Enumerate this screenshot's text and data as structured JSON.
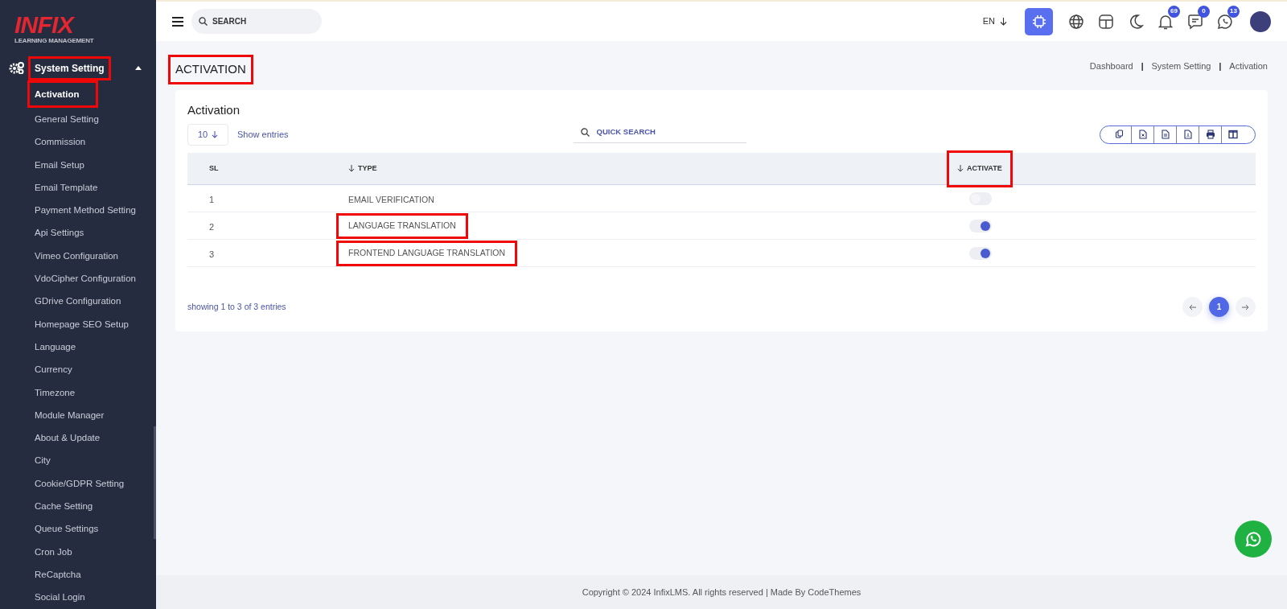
{
  "logo": {
    "title": "INFIX",
    "subtitle": "LEARNING MANAGEMENT"
  },
  "sidebar": {
    "section": {
      "label": "System Setting",
      "expanded": true,
      "highlighted": true
    },
    "items": [
      {
        "label": "Activation",
        "selected": true,
        "highlighted": true
      },
      {
        "label": "General Setting",
        "selected": false,
        "highlighted": false
      },
      {
        "label": "Commission",
        "selected": false,
        "highlighted": false
      },
      {
        "label": "Email Setup",
        "selected": false,
        "highlighted": false
      },
      {
        "label": "Email Template",
        "selected": false,
        "highlighted": false
      },
      {
        "label": "Payment Method Setting",
        "selected": false,
        "highlighted": false
      },
      {
        "label": "Api Settings",
        "selected": false,
        "highlighted": false
      },
      {
        "label": "Vimeo Configuration",
        "selected": false,
        "highlighted": false
      },
      {
        "label": "VdoCipher Configuration",
        "selected": false,
        "highlighted": false
      },
      {
        "label": "GDrive Configuration",
        "selected": false,
        "highlighted": false
      },
      {
        "label": "Homepage SEO Setup",
        "selected": false,
        "highlighted": false
      },
      {
        "label": "Language",
        "selected": false,
        "highlighted": false
      },
      {
        "label": "Currency",
        "selected": false,
        "highlighted": false
      },
      {
        "label": "Timezone",
        "selected": false,
        "highlighted": false
      },
      {
        "label": "Module Manager",
        "selected": false,
        "highlighted": false
      },
      {
        "label": "About & Update",
        "selected": false,
        "highlighted": false
      },
      {
        "label": "City",
        "selected": false,
        "highlighted": false
      },
      {
        "label": "Cookie/GDPR Setting",
        "selected": false,
        "highlighted": false
      },
      {
        "label": "Cache Setting",
        "selected": false,
        "highlighted": false
      },
      {
        "label": "Queue Settings",
        "selected": false,
        "highlighted": false
      },
      {
        "label": "Cron Job",
        "selected": false,
        "highlighted": false
      },
      {
        "label": "ReCaptcha",
        "selected": false,
        "highlighted": false
      },
      {
        "label": "Social Login",
        "selected": false,
        "highlighted": false
      }
    ]
  },
  "topbar": {
    "search": {
      "placeholder": "SEARCH"
    },
    "language": "EN",
    "icons": [
      {
        "kind": "ai"
      },
      {
        "kind": "globe"
      },
      {
        "kind": "layout"
      },
      {
        "kind": "moon"
      },
      {
        "kind": "bell",
        "count": "69"
      },
      {
        "kind": "chat",
        "count": "0"
      },
      {
        "kind": "phone",
        "count": "13"
      }
    ]
  },
  "page": {
    "title": "ACTIVATION",
    "title_highlighted": true,
    "breadcrumbs": [
      {
        "kind": "link",
        "label": "Dashboard"
      },
      {
        "kind": "separator",
        "label": "|"
      },
      {
        "kind": "link",
        "label": "System Setting"
      },
      {
        "kind": "separator",
        "label": "|"
      },
      {
        "kind": "link",
        "label": "Activation"
      }
    ]
  },
  "card": {
    "title": "Activation",
    "page_size": "10",
    "show_entries": "Show entries",
    "quick_search": {
      "placeholder": "QUICK SEARCH"
    },
    "export_buttons": [
      {
        "kind": "copy"
      },
      {
        "kind": "excel"
      },
      {
        "kind": "csv"
      },
      {
        "kind": "pdf"
      },
      {
        "kind": "print"
      },
      {
        "kind": "columns"
      }
    ],
    "columns": [
      {
        "label": "SL",
        "sortable": false,
        "highlighted": false
      },
      {
        "label": "TYPE",
        "sortable": true,
        "highlighted": false
      },
      {
        "label": "ACTIVATE",
        "sortable": true,
        "highlighted": true
      }
    ],
    "rows": [
      {
        "sl": "1",
        "type": "EMAIL VERIFICATION",
        "highlighted": false,
        "active": false
      },
      {
        "sl": "2",
        "type": "LANGUAGE TRANSLATION",
        "highlighted": true,
        "active": true
      },
      {
        "sl": "3",
        "type": "FRONTEND LANGUAGE TRANSLATION",
        "highlighted": true,
        "active": true
      }
    ],
    "summary": "showing 1 to 3 of 3 entries",
    "pages": [
      {
        "label": "1",
        "selected": true
      }
    ]
  },
  "footer": "Copyright © 2024 InfixLMS. All rights reserved | Made By CodeThemes"
}
